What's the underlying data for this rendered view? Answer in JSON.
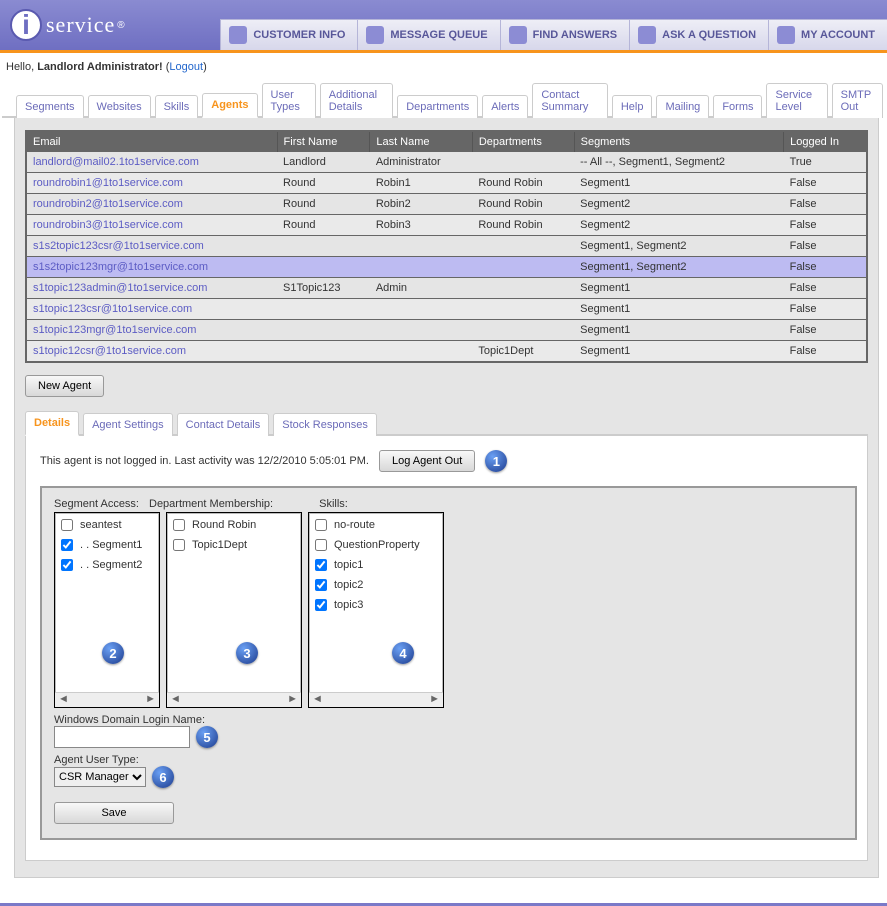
{
  "brand": {
    "name": "service",
    "reg": "®"
  },
  "mainnav": [
    {
      "label": "CUSTOMER INFO"
    },
    {
      "label": "MESSAGE QUEUE"
    },
    {
      "label": "FIND ANSWERS"
    },
    {
      "label": "ASK A QUESTION"
    },
    {
      "label": "MY ACCOUNT"
    }
  ],
  "greeting": {
    "hello": "Hello, ",
    "user": "Landlord Administrator!",
    "open": "  (",
    "logout": "Logout",
    "close": ")"
  },
  "tabs": [
    "Segments",
    "Websites",
    "Skills",
    "Agents",
    "User Types",
    "Additional Details",
    "Departments",
    "Alerts",
    "Contact Summary",
    "Help",
    "Mailing",
    "Forms",
    "Service Level",
    "SMTP Out"
  ],
  "active_tab_index": 3,
  "table": {
    "headers": [
      "Email",
      "First Name",
      "Last Name",
      "Departments",
      "Segments",
      "Logged In"
    ],
    "rows": [
      {
        "email": "landlord@mail02.1to1service.com",
        "first": "Landlord",
        "last": "Administrator",
        "dept": "",
        "seg": "-- All --, Segment1, Segment2",
        "logged": "True",
        "sel": false,
        "stripe": false
      },
      {
        "email": "roundrobin1@1to1service.com",
        "first": "Round",
        "last": "Robin1",
        "dept": "Round Robin",
        "seg": "Segment1",
        "logged": "False",
        "sel": false,
        "stripe": true
      },
      {
        "email": "roundrobin2@1to1service.com",
        "first": "Round",
        "last": "Robin2",
        "dept": "Round Robin",
        "seg": "Segment2",
        "logged": "False",
        "sel": false,
        "stripe": false
      },
      {
        "email": "roundrobin3@1to1service.com",
        "first": "Round",
        "last": "Robin3",
        "dept": "Round Robin",
        "seg": "Segment2",
        "logged": "False",
        "sel": false,
        "stripe": true
      },
      {
        "email": "s1s2topic123csr@1to1service.com",
        "first": "",
        "last": "",
        "dept": "",
        "seg": "Segment1, Segment2",
        "logged": "False",
        "sel": false,
        "stripe": false
      },
      {
        "email": "s1s2topic123mgr@1to1service.com",
        "first": "",
        "last": "",
        "dept": "",
        "seg": "Segment1, Segment2",
        "logged": "False",
        "sel": true,
        "stripe": false
      },
      {
        "email": "s1topic123admin@1to1service.com",
        "first": "S1Topic123",
        "last": "Admin",
        "dept": "",
        "seg": "Segment1",
        "logged": "False",
        "sel": false,
        "stripe": false
      },
      {
        "email": "s1topic123csr@1to1service.com",
        "first": "",
        "last": "",
        "dept": "",
        "seg": "Segment1",
        "logged": "False",
        "sel": false,
        "stripe": true
      },
      {
        "email": "s1topic123mgr@1to1service.com",
        "first": "",
        "last": "",
        "dept": "",
        "seg": "Segment1",
        "logged": "False",
        "sel": false,
        "stripe": false
      },
      {
        "email": "s1topic12csr@1to1service.com",
        "first": "",
        "last": "",
        "dept": "Topic1Dept",
        "seg": "Segment1",
        "logged": "False",
        "sel": false,
        "stripe": true
      }
    ]
  },
  "buttons": {
    "new_agent": "New Agent",
    "log_out": "Log Agent Out",
    "save": "Save"
  },
  "subtabs": [
    "Details",
    "Agent Settings",
    "Contact Details",
    "Stock Responses"
  ],
  "active_subtab_index": 0,
  "status_line": "This agent is not logged in. Last activity was 12/2/2010 5:05:01 PM.",
  "details": {
    "seg_label": "Segment Access:",
    "dept_label": "Department Membership:",
    "skills_label": "Skills:",
    "segments": [
      {
        "label": "seantest",
        "checked": false
      },
      {
        "label": ". . Segment1",
        "checked": true
      },
      {
        "label": ". . Segment2",
        "checked": true
      }
    ],
    "departments": [
      {
        "label": "Round Robin",
        "checked": false
      },
      {
        "label": "Topic1Dept",
        "checked": false
      }
    ],
    "skills": [
      {
        "label": "no-route",
        "checked": false
      },
      {
        "label": "QuestionProperty",
        "checked": false
      },
      {
        "label": "topic1",
        "checked": true
      },
      {
        "label": "topic2",
        "checked": true
      },
      {
        "label": "topic3",
        "checked": true
      }
    ],
    "win_label": "Windows Domain Login Name:",
    "win_value": "",
    "usertype_label": "Agent User Type:",
    "usertype_value": "CSR Manager"
  },
  "callouts": {
    "c1": "1",
    "c2": "2",
    "c3": "3",
    "c4": "4",
    "c5": "5",
    "c6": "6"
  }
}
